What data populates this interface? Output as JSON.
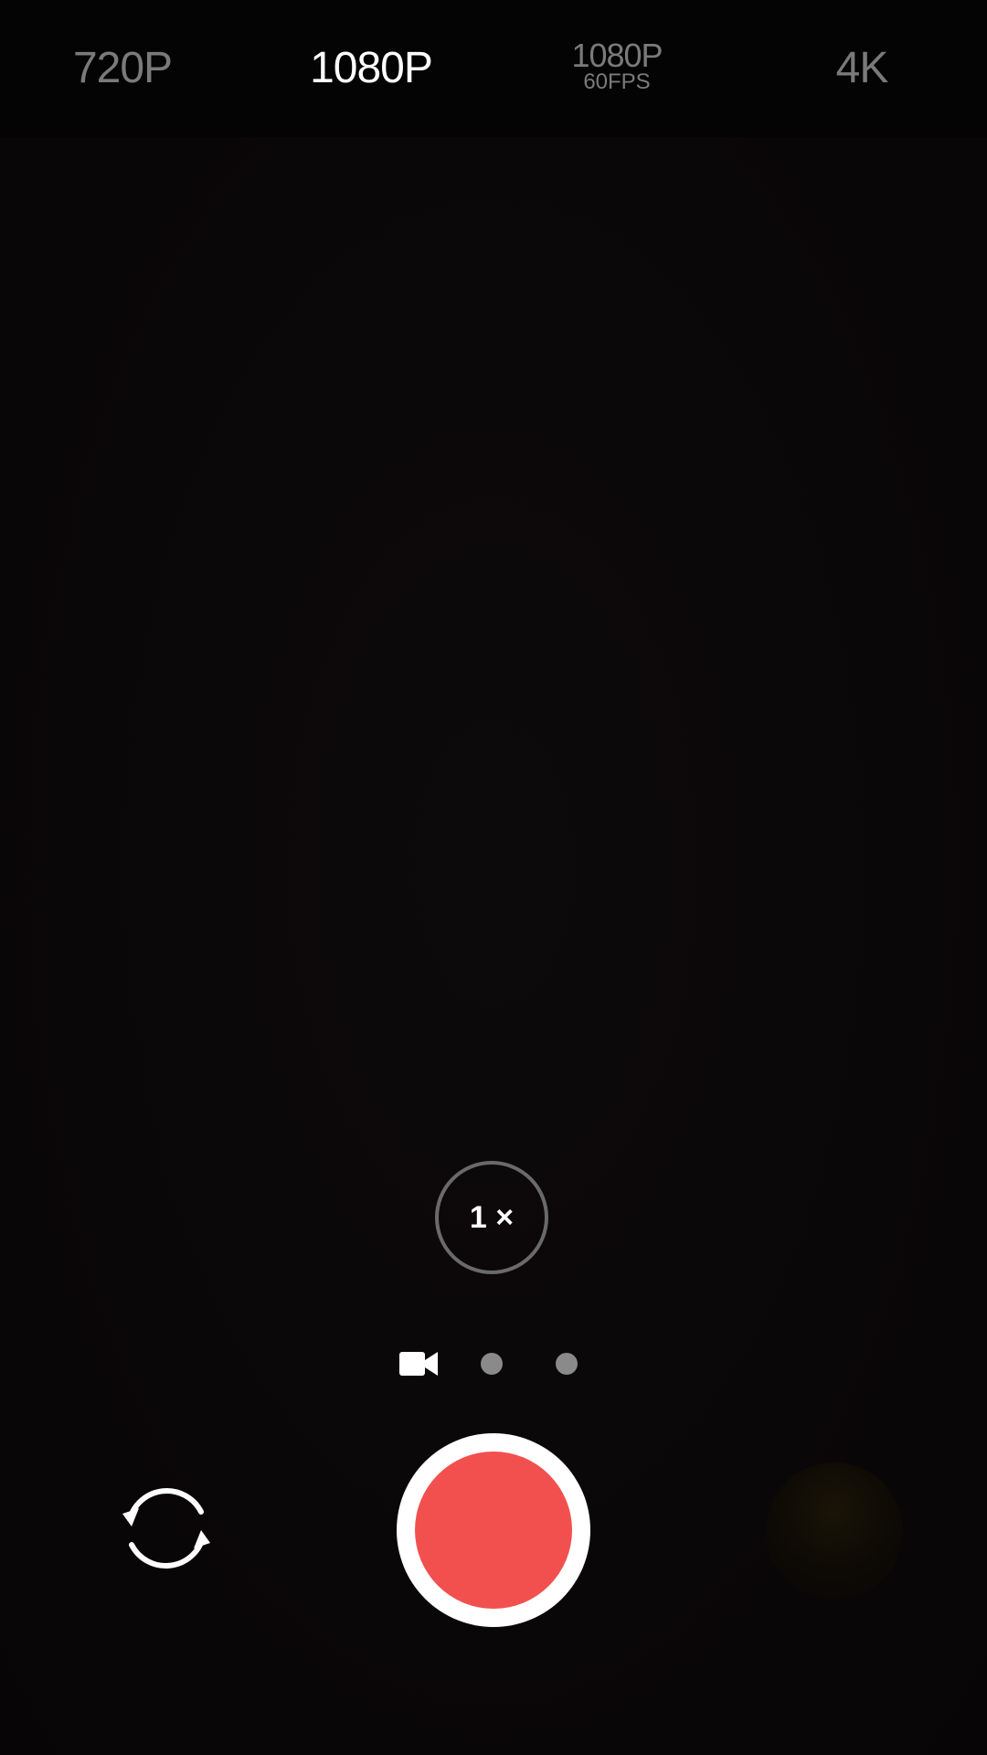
{
  "resolution_options": [
    {
      "label": "720P",
      "sub": "",
      "active": false
    },
    {
      "label": "1080P",
      "sub": "",
      "active": true
    },
    {
      "label": "1080P",
      "sub": "60FPS",
      "active": false
    },
    {
      "label": "4K",
      "sub": "",
      "active": false
    }
  ],
  "zoom": {
    "label": "1 ×"
  },
  "modes": [
    {
      "icon": "video-camera-icon",
      "active": true
    },
    {
      "icon": "dot",
      "active": false
    },
    {
      "icon": "dot",
      "active": false
    }
  ],
  "colors": {
    "shutter_red": "#f2504e",
    "inactive_text": "#7a7a7a",
    "active_text": "#ffffff"
  }
}
